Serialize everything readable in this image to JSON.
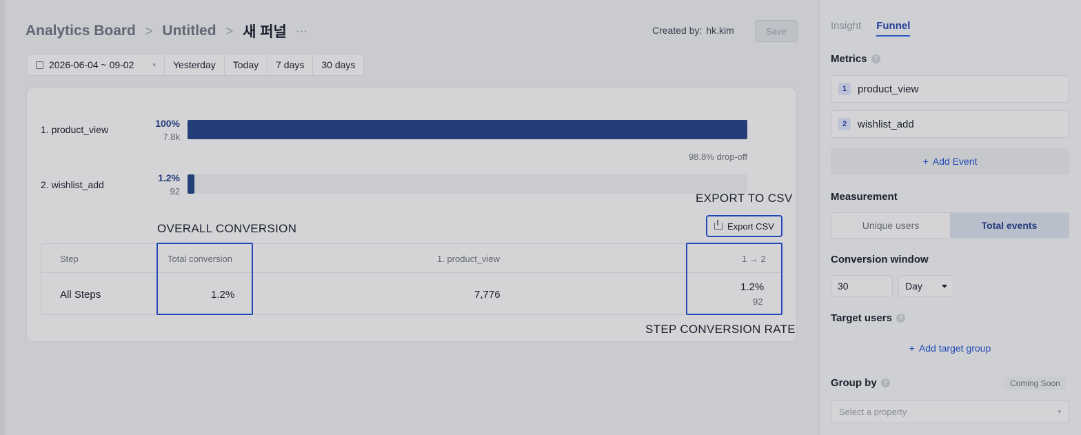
{
  "breadcrumb": {
    "board": "Analytics Board",
    "separator": ">",
    "page": "Untitled",
    "current": "새 퍼널",
    "more": "···"
  },
  "header": {
    "created_by_label": "Created by:",
    "created_by_user": "hk.kim",
    "save_label": "Save"
  },
  "date_filter": {
    "range": "2026-06-04 ~ 09-02",
    "presets": [
      "Yesterday",
      "Today",
      "7 days",
      "30 days"
    ]
  },
  "funnel": {
    "steps": [
      {
        "label": "1. product_view",
        "percent": "100%",
        "count": "7.8k",
        "fraction": 1.0
      },
      {
        "label": "2. wishlist_add",
        "percent": "1.2%",
        "count": "92",
        "fraction": 0.012
      }
    ],
    "dropoff": "98.8% drop-off",
    "bar_color": "#1e3f8a"
  },
  "annotations": {
    "export": "EXPORT TO CSV",
    "overall": "OVERALL CONVERSION",
    "step_rate": "STEP CONVERSION RATE",
    "highlight_color": "#1d4ed8"
  },
  "export_button": {
    "label": "Export CSV",
    "icon": "download-icon"
  },
  "table": {
    "headers": {
      "step": "Step",
      "total": "Total conversion",
      "step1": "1. product_view",
      "step12": "1 → 2"
    },
    "row": {
      "step": "All Steps",
      "total": "1.2%",
      "step1": "7,776",
      "step12_pct": "1.2%",
      "step12_count": "92"
    }
  },
  "panel": {
    "tabs": [
      {
        "label": "Insight",
        "active": false
      },
      {
        "label": "Funnel",
        "active": true
      }
    ],
    "metrics_title": "Metrics",
    "metrics": [
      {
        "num": "1",
        "name": "product_view"
      },
      {
        "num": "2",
        "name": "wishlist_add"
      }
    ],
    "add_event": "Add Event",
    "measurement_title": "Measurement",
    "measurement_options": [
      "Unique users",
      "Total events"
    ],
    "measurement_selected": "Total events",
    "conversion_window_title": "Conversion window",
    "conversion_window_value": "30",
    "conversion_window_unit": "Day",
    "target_users_title": "Target users",
    "add_target_group": "Add target group",
    "group_by_title": "Group by",
    "coming_soon": "Coming Soon",
    "select_property_placeholder": "Select a property"
  }
}
